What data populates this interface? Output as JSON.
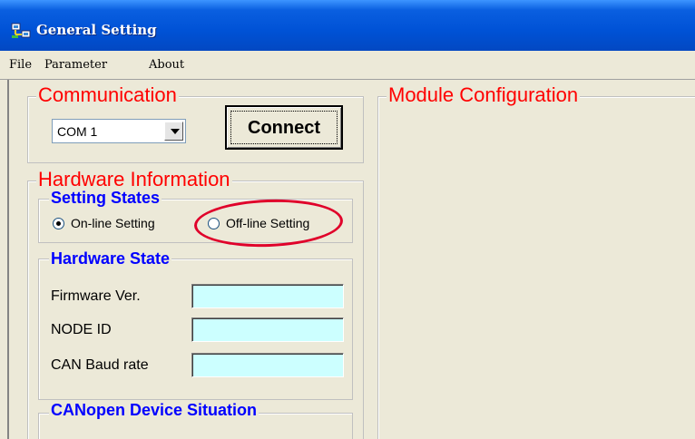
{
  "window": {
    "title": "General Setting"
  },
  "menu": {
    "items": [
      "File",
      "Parameter",
      "About"
    ]
  },
  "communication": {
    "legend": "Communication",
    "port_value": "COM 1",
    "connect_label": "Connect"
  },
  "module_configuration": {
    "legend": "Module Configuration"
  },
  "hardware_information": {
    "legend": "Hardware Information",
    "setting_states": {
      "legend": "Setting States",
      "options": [
        {
          "label": "On-line Setting",
          "selected": true
        },
        {
          "label": "Off-line Setting",
          "selected": false
        }
      ]
    },
    "hardware_state": {
      "legend": "Hardware State",
      "fields": [
        {
          "label": "Firmware Ver.",
          "value": ""
        },
        {
          "label": "NODE ID",
          "value": ""
        },
        {
          "label": "CAN Baud rate",
          "value": ""
        }
      ]
    },
    "device_situation": {
      "legend": "CANopen Device Situation"
    }
  },
  "colors": {
    "section_title": "#ff0000",
    "subsection_title": "#0000ff",
    "readout_background": "#ccffff",
    "annotation_circle": "#e0002a",
    "title_bar": "#0052d6"
  }
}
